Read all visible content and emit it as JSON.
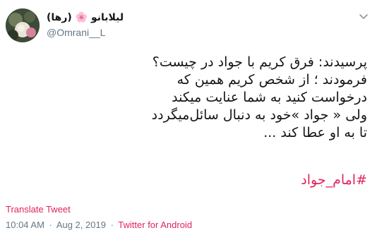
{
  "user": {
    "display_name": "لیلابانو 🌸 (رها)",
    "handle": "@Omrani__L"
  },
  "tweet": {
    "lines": [
      "پرسیدند: فرق کریم با جواد در چیست؟",
      "فرمودند ؛ از شخص کریم همین که",
      "درخواست کنید به شما عنایت میکند",
      "ولی « جواد »خود به دنبال سائل‌میگردد",
      "تا به او عطا کند ..."
    ],
    "hashtag": "#امام_جواد"
  },
  "footer": {
    "translate_label": "Translate Tweet",
    "time": "10:04 AM",
    "separator": "·",
    "date": "Aug 2, 2019",
    "source": "Twitter for Android"
  },
  "colors": {
    "accent": "#e0245e",
    "secondary_text": "#657786",
    "primary_text": "#14171a"
  },
  "icons": {
    "menu": "chevron-down-icon"
  }
}
